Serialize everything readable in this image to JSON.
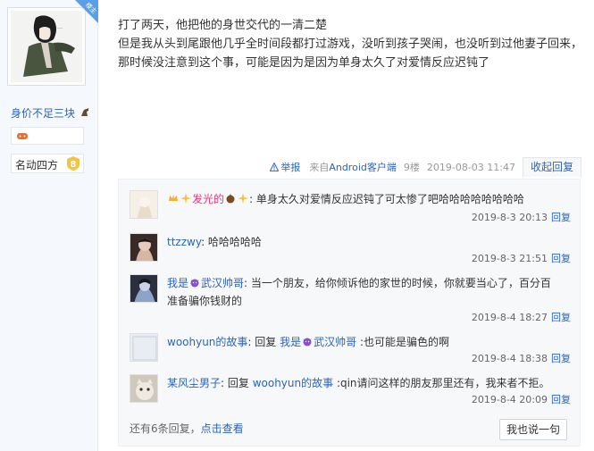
{
  "user": {
    "name": "身价不足三块",
    "badge": "楼主",
    "level_name": "名动四方",
    "level": "8"
  },
  "post": {
    "lines": [
      "打了两天，他把他的身世交代的一清二楚",
      "但是我从头到尾跟他几乎全时间段都打过游戏，没听到孩子哭闹，也没听到过他妻子回来，",
      "那时候没注意到这个事，可能是因为是因为单身太久了对爱情反应迟钝了"
    ],
    "report": "举报",
    "from_prefix": "来自",
    "from_client": "Android客户端",
    "floor": "9楼",
    "time": "2019-08-03 11:47",
    "collapse": "收起回复"
  },
  "replies": [
    {
      "user": "发光的",
      "text": ": 单身太久对爱情反应迟钝了可太惨了吧哈哈哈哈哈哈哈哈",
      "time": "2019-8-3 20:13",
      "reply_label": "回复"
    },
    {
      "user": "ttzzwy",
      "text": ": 哈哈哈哈哈",
      "time": "2019-8-3 21:51",
      "reply_label": "回复"
    },
    {
      "user_prefix": "我是",
      "user": "武汉帅哥",
      "text_line1": ": 当一个朋友，给你倾诉他的家世的时候，你就要当心了，百分百",
      "text_line2": "准备骗你钱财的",
      "time": "2019-8-4 18:27",
      "reply_label": "回复"
    },
    {
      "user": "woohyun的故事",
      "reply_word": ": 回复 ",
      "target_prefix": "我是",
      "target": "武汉帅哥",
      "text": " :也可能是骗色的啊",
      "time": "2019-8-4 18:38",
      "reply_label": "回复"
    },
    {
      "user": "某风尘男子",
      "reply_word": ": 回复 ",
      "target": "woohyun的故事",
      "text": " :qin请问这样的朋友那里还有，我来者不拒。",
      "time": "2019-8-4 20:09",
      "reply_label": "回复"
    }
  ],
  "more": {
    "prefix": "还有6条回复，",
    "link": "点击查看"
  },
  "say_button": "我也说一句",
  "colors": {
    "link": "#2d64b3",
    "pink_name": "#e8387a",
    "panel_bg": "#f7f8fa"
  }
}
